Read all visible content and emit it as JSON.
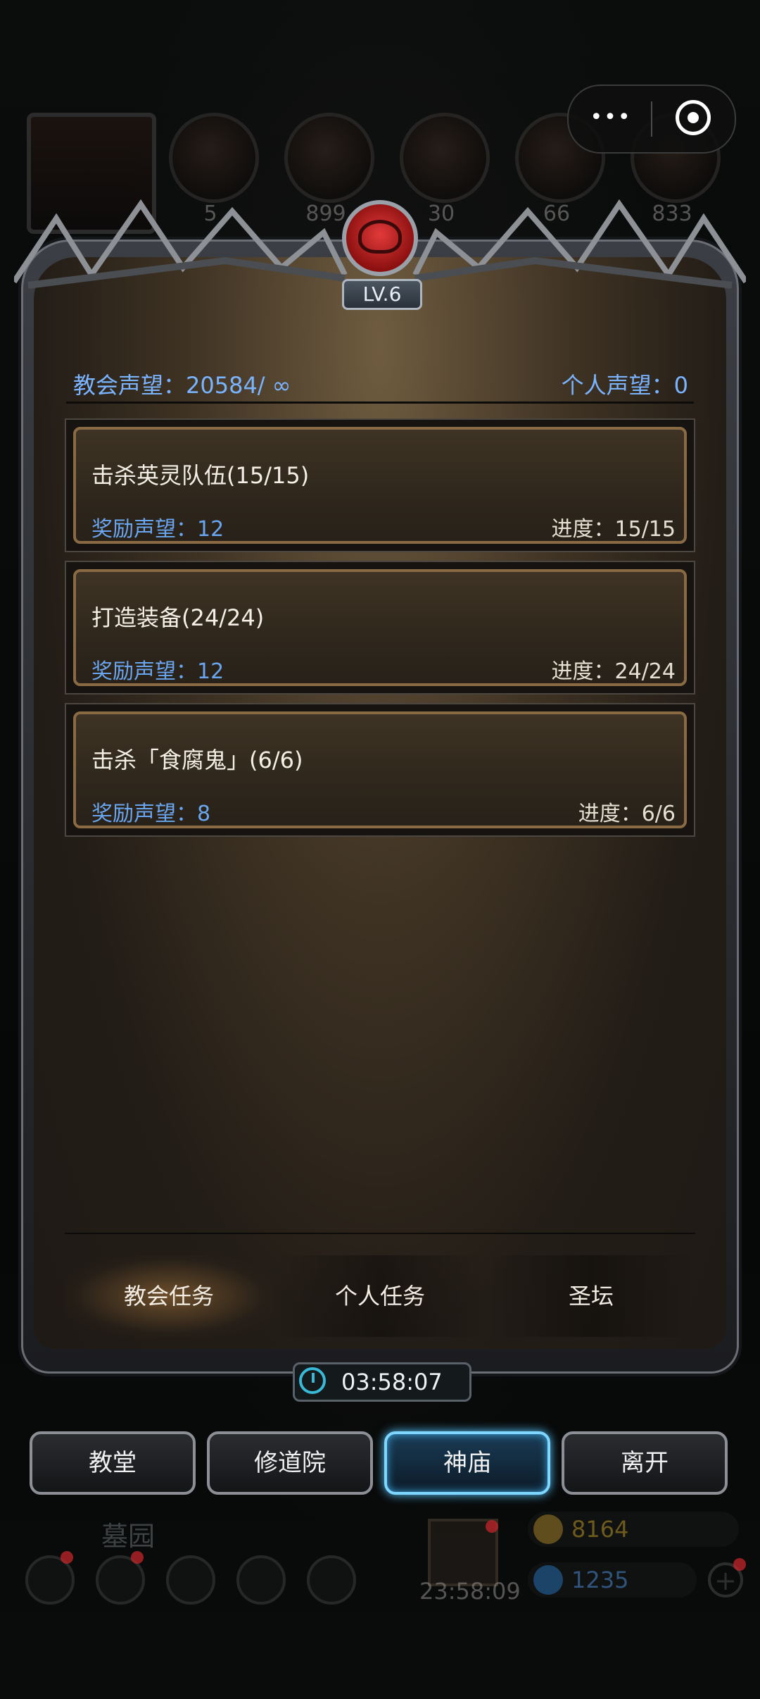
{
  "top_resources": {
    "counts": [
      "5",
      "899",
      "30",
      "66",
      "833"
    ]
  },
  "level_badge": "LV.6",
  "reputation": {
    "church_label": "教会声望：20584/ ∞",
    "personal_label": "个人声望：0"
  },
  "tasks": [
    {
      "title": "击杀英灵队伍(15/15)",
      "reward": "奖励声望：12",
      "progress": "进度：15/15"
    },
    {
      "title": "打造装备(24/24)",
      "reward": "奖励声望：12",
      "progress": "进度：24/24"
    },
    {
      "title": "击杀「食腐鬼」(6/6)",
      "reward": "奖励声望：8",
      "progress": "进度：6/6"
    }
  ],
  "tabs": [
    {
      "label": "教会任务",
      "active": true
    },
    {
      "label": "个人任务",
      "active": false
    },
    {
      "label": "圣坛",
      "active": false
    }
  ],
  "timer": "03:58:07",
  "nav": [
    {
      "label": "教堂",
      "active": false
    },
    {
      "label": "修道院",
      "active": false
    },
    {
      "label": "神庙",
      "active": true
    },
    {
      "label": "离开",
      "active": false
    }
  ],
  "hud": {
    "location": "墓园",
    "gift_timer": "23:58:09",
    "gold": "8164",
    "gems": "1235"
  },
  "colors": {
    "accent_blue": "#7ab4ff",
    "active_nav_glow": "#57c6ff",
    "card_border": "#8a6a42"
  }
}
